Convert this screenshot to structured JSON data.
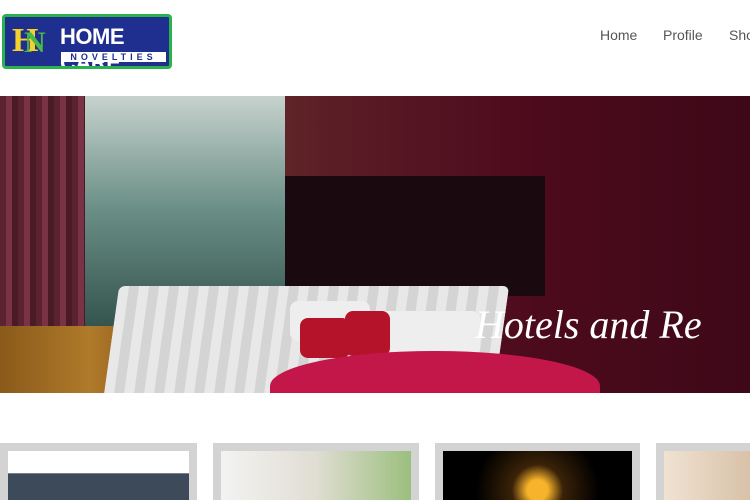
{
  "logo": {
    "mark": "HCN",
    "title": "HOME CARE",
    "subtitle": "NOVELTIES"
  },
  "nav": {
    "items": [
      "Home",
      "Profile",
      "Sho"
    ]
  },
  "hero": {
    "caption": "Hotels and Re"
  },
  "thumbs": [
    "thumb-1",
    "thumb-2",
    "thumb-3",
    "thumb-4"
  ]
}
